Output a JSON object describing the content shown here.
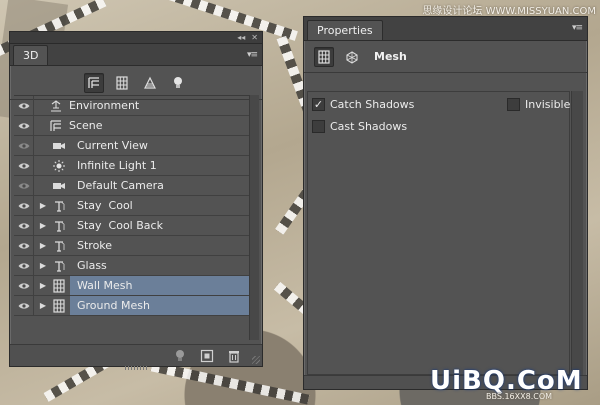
{
  "watermark_top": "思缘设计论坛 WWW.MISSYUAN.COM",
  "watermark_logo": "UiBQ.CoM",
  "watermark_bottom": "BBS.16XX8.COM",
  "panel_3d": {
    "tab_label": "3D",
    "topbar_collapse": "◂◂",
    "topbar_close": "✕",
    "menu_icon": "▾≡",
    "filter_buttons": [
      {
        "icon": "scene-filter-icon",
        "active": true
      },
      {
        "icon": "mesh-filter-icon",
        "active": false
      },
      {
        "icon": "materials-filter-icon",
        "active": false
      },
      {
        "icon": "lights-filter-icon",
        "active": false
      }
    ],
    "layers": [
      {
        "label": "Environment",
        "icon": "environment-icon",
        "indent": 0,
        "expander": false,
        "eye": true,
        "selected": false
      },
      {
        "label": "Scene",
        "icon": "scene-icon",
        "indent": 0,
        "expander": false,
        "eye": true,
        "selected": false
      },
      {
        "label": "Current View",
        "icon": "camera-icon",
        "indent": 1,
        "expander": false,
        "eye": false,
        "selected": false
      },
      {
        "label": "Infinite Light 1",
        "icon": "light-icon",
        "indent": 1,
        "expander": false,
        "eye": true,
        "selected": false
      },
      {
        "label": "Default Camera",
        "icon": "camera-icon",
        "indent": 1,
        "expander": false,
        "eye": false,
        "selected": false
      },
      {
        "label": "Stay  Cool",
        "icon": "3d-text-icon",
        "indent": 1,
        "expander": true,
        "eye": true,
        "selected": false
      },
      {
        "label": "Stay  Cool Back",
        "icon": "3d-text-icon",
        "indent": 1,
        "expander": true,
        "eye": true,
        "selected": false
      },
      {
        "label": "Stroke",
        "icon": "3d-text-icon",
        "indent": 1,
        "expander": true,
        "eye": true,
        "selected": false
      },
      {
        "label": "Glass",
        "icon": "3d-text-icon",
        "indent": 1,
        "expander": true,
        "eye": true,
        "selected": false
      },
      {
        "label": "Wall Mesh",
        "icon": "mesh-icon",
        "indent": 1,
        "expander": true,
        "eye": true,
        "selected": true
      },
      {
        "label": "Ground Mesh",
        "icon": "mesh-icon",
        "indent": 1,
        "expander": true,
        "eye": true,
        "selected": true
      }
    ],
    "bottom_buttons": [
      {
        "icon": "add-light-icon"
      },
      {
        "icon": "render-icon"
      },
      {
        "icon": "trash-icon"
      }
    ]
  },
  "panel_props": {
    "tab_label": "Properties",
    "menu_icon": "▾≡",
    "header_title": "Mesh",
    "header_icons": [
      "mesh-tab-icon",
      "coordinates-tab-icon"
    ],
    "checkboxes": [
      {
        "label": "Catch Shadows",
        "checked": true
      },
      {
        "label": "Invisible",
        "checked": false
      },
      {
        "label": "Cast Shadows",
        "checked": false
      }
    ]
  },
  "colors": {
    "panel_bg": "#535353",
    "selection": "#6b7f99",
    "tab_strip": "#424242"
  }
}
